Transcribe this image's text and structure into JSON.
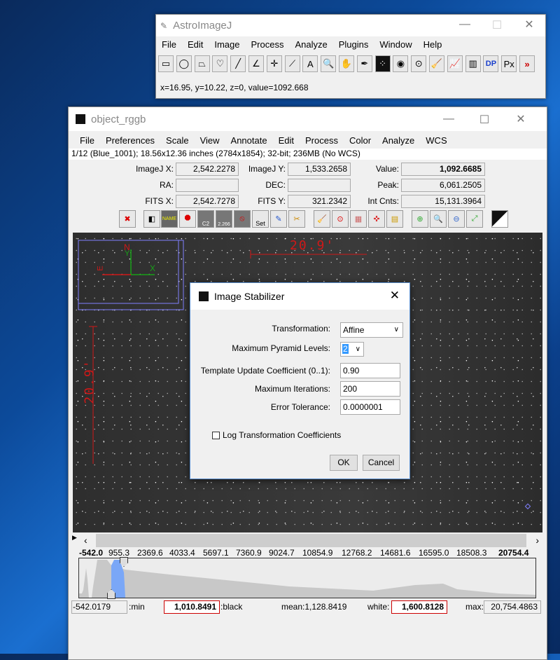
{
  "main_window": {
    "title": "AstroImageJ",
    "menu": [
      "File",
      "Edit",
      "Image",
      "Process",
      "Analyze",
      "Plugins",
      "Window",
      "Help"
    ],
    "tools": [
      {
        "icon": "rectangle-icon",
        "glyph": "▭"
      },
      {
        "icon": "oval-icon",
        "glyph": "◯"
      },
      {
        "icon": "polygon-icon",
        "glyph": "⏢"
      },
      {
        "icon": "freehand-icon",
        "glyph": "♡"
      },
      {
        "icon": "line-icon",
        "glyph": "╱"
      },
      {
        "icon": "angle-icon",
        "glyph": "∠"
      },
      {
        "icon": "point-icon",
        "glyph": "✛"
      },
      {
        "icon": "wand-icon",
        "glyph": "⟋"
      },
      {
        "icon": "text-icon",
        "glyph": "A"
      },
      {
        "icon": "magnifier-icon",
        "glyph": "🔍"
      },
      {
        "icon": "hand-icon",
        "glyph": "✋"
      },
      {
        "icon": "dropper-icon",
        "glyph": "✒"
      },
      {
        "icon": "star-field-icon",
        "glyph": "⁘"
      },
      {
        "icon": "aperture-icon",
        "glyph": "◉"
      },
      {
        "icon": "multi-aperture-icon",
        "glyph": "⊙"
      },
      {
        "icon": "broom-icon",
        "glyph": "🧹"
      },
      {
        "icon": "plot-icon",
        "glyph": "📈"
      },
      {
        "icon": "table-icon",
        "glyph": "▥"
      },
      {
        "icon": "dp-icon",
        "glyph": "DP"
      },
      {
        "icon": "pixel-zoom-icon",
        "glyph": "Px"
      },
      {
        "icon": "more-icon",
        "glyph": "»"
      }
    ],
    "status": "x=16.95, y=10.22, z=0, value=1092.668"
  },
  "image_window": {
    "title": "object_rggb",
    "menu": [
      "File",
      "Preferences",
      "Scale",
      "View",
      "Annotate",
      "Edit",
      "Process",
      "Color",
      "Analyze",
      "WCS"
    ],
    "info": "1/12 (Blue_1001); 18.56x12.36 inches (2784x1854); 32-bit; 236MB (No WCS)",
    "fields": {
      "imagej_x_label": "ImageJ X:",
      "imagej_x": "2,542.2278",
      "imagej_y_label": "ImageJ Y:",
      "imagej_y": "1,533.2658",
      "value_label": "Value:",
      "value": "1,092.6685",
      "ra_label": "RA:",
      "ra": "",
      "dec_label": "DEC:",
      "dec": "",
      "peak_label": "Peak:",
      "peak": "6,061.2505",
      "fits_x_label": "FITS X:",
      "fits_x": "2,542.7278",
      "fits_y_label": "FITS Y:",
      "fits_y": "321.2342",
      "int_cnts_label": "Int Cnts:",
      "int_cnts": "15,131.3964"
    },
    "overlay": {
      "scale_h": "20.9'",
      "scale_v": "20.9'",
      "north": "N",
      "east": "E",
      "x_axis": "X",
      "y_axis": "Y"
    },
    "icon_labels": {
      "c2": "C2",
      "r": "2.266",
      "set": "Set",
      "name": "NAME"
    },
    "histogram": {
      "ticks": [
        "-542.0",
        "955.3",
        "2369.6",
        "4033.4",
        "5697.1",
        "7360.9",
        "9024.7",
        "10854.9",
        "12768.2",
        "14681.6",
        "16595.0",
        "18508.3",
        "20754.4"
      ],
      "min": "-542.0179",
      "min_label": ":min",
      "black": "1,010.8491",
      "black_label": ":black",
      "mean": "mean:1,128.8419",
      "white_label": "white:",
      "white": "1,600.8128",
      "max_label": "max:",
      "max": "20,754.4863"
    }
  },
  "dialog": {
    "title": "Image Stabilizer",
    "transformation_label": "Transformation:",
    "transformation": "Affine",
    "pyramid_label": "Maximum Pyramid Levels:",
    "pyramid": "2",
    "template_label": "Template Update Coefficient (0..1):",
    "template": "0.90",
    "iterations_label": "Maximum Iterations:",
    "iterations": "200",
    "tolerance_label": "Error Tolerance:",
    "tolerance": "0.0000001",
    "log_label": "Log Transformation Coefficients",
    "log_checked": false,
    "ok": "OK",
    "cancel": "Cancel"
  },
  "colors": {
    "accent": "#5a8fd0",
    "overlay_red": "#d01818",
    "overlay_green": "#18a018",
    "histogram_fill": "#7aa7f7"
  }
}
